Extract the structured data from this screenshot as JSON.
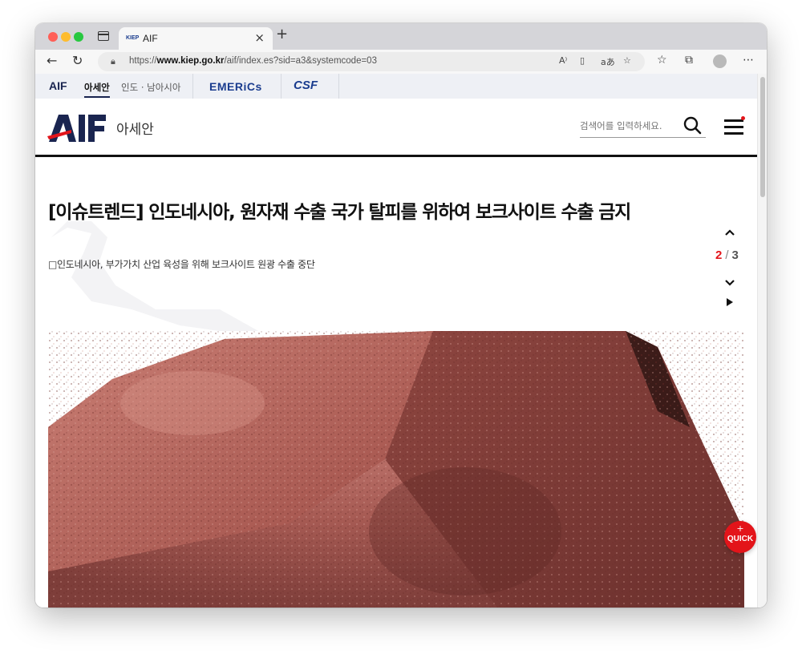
{
  "browser": {
    "tab_favicon": "KIEP",
    "tab_title": "AIF",
    "tab_close": "×",
    "new_tab": "+",
    "url_prefix": "https://",
    "url_domain": "www.kiep.go.kr",
    "url_path": "/aif/index.es?sid=a3&systemcode=03",
    "icons": [
      "back-icon",
      "refresh-icon",
      "lock-icon",
      "read-aloud-icon",
      "immersive-reader-icon",
      "translate-icon",
      "favorite-add-icon",
      "favorites-icon",
      "collections-icon",
      "profile-icon",
      "more-icon"
    ]
  },
  "site_strip": {
    "aif": "AIF",
    "asean": "아세안",
    "india": "인도 · 남아시아",
    "emerics": "EMERiCs",
    "csf": "CSF"
  },
  "header": {
    "logo": "AIF",
    "logo_sub": "아세안",
    "search_placeholder": "검색어를 입력하세요."
  },
  "article": {
    "title": "[이슈트렌드] 인도네시아, 원자재 수출 국가 탈피를 위하여 보크사이트 수출 금지",
    "subtitle": "□인도네시아, 부가가치 산업 육성을 위해 보크사이트 원광 수출 중단",
    "image": "bauxite-rock-photo"
  },
  "pager": {
    "current": "2",
    "separator": "/",
    "total": "3"
  },
  "quick": {
    "plus": "+",
    "label": "QUICK"
  },
  "colors": {
    "accent_red": "#e3141a",
    "brand_navy": "#1a2550",
    "brand_blue": "#1a3c8e"
  }
}
